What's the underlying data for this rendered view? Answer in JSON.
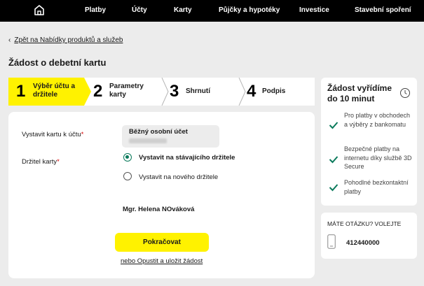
{
  "topnav": {
    "home_icon": "home-icon",
    "items": [
      {
        "label": "Platby"
      },
      {
        "label": "Účty"
      },
      {
        "label": "Karty"
      },
      {
        "label": "Půjčky a hypotéky"
      },
      {
        "label": "Investice"
      },
      {
        "label": "Stavební spoření"
      }
    ]
  },
  "back_link": "Zpět na Nabídky produktů a služeb",
  "page_title": "Žádost o debetní kartu",
  "steps": [
    {
      "number": "1",
      "line1": "Výběr účtu a",
      "line2": "držitele",
      "active": true
    },
    {
      "number": "2",
      "line1": "Parametry",
      "line2": "karty",
      "active": false
    },
    {
      "number": "3",
      "line1": "Shrnutí",
      "line2": "",
      "active": false
    },
    {
      "number": "4",
      "line1": "Podpis",
      "line2": "",
      "active": false
    }
  ],
  "form": {
    "account_label": "Vystavit kartu k účtu",
    "account_value": "Běžný osobní účet",
    "holder_label": "Držitel karty",
    "required_mark": "*",
    "options": [
      {
        "label": "Vystavit na stávajícího držitele",
        "checked": true
      },
      {
        "label": "Vystavit na nového držitele",
        "checked": false
      }
    ],
    "holder_name": "Mgr. Helena NOváková",
    "continue_label": "Pokračovat",
    "save_link": "nebo Opustit a uložit žádost"
  },
  "info": {
    "title": "Žádost vyřídíme do 10 minut",
    "items": [
      {
        "text": "Pro platby v obchodech a výběry z bankomatu"
      },
      {
        "text": "Bezpečné platby na internetu díky službě 3D Secure"
      },
      {
        "text": "Pohodlné bezkontaktní platby"
      }
    ]
  },
  "contact": {
    "title": "MÁTE OTÁZKU? VOLEJTE",
    "phone": "412440000"
  },
  "colors": {
    "nav_bg": "#000000",
    "accent_yellow": "#fff200",
    "check_green": "#0a7a5b",
    "page_bg": "#ececec"
  }
}
